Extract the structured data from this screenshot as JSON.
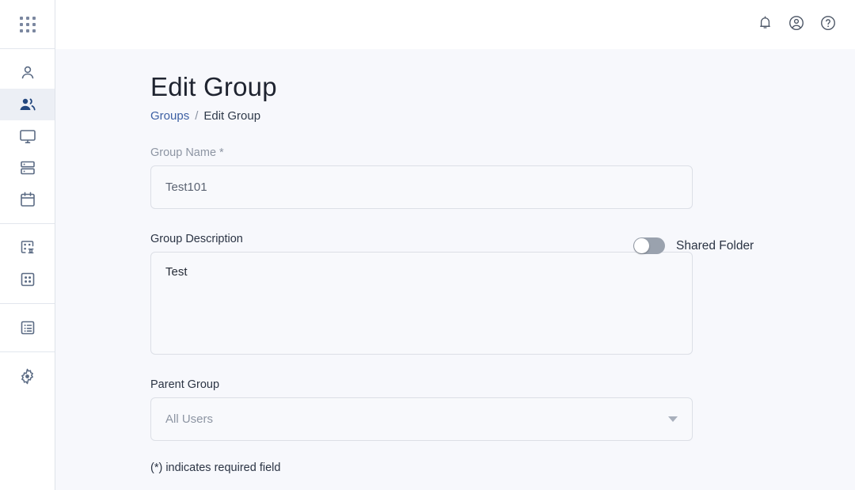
{
  "sidebar": {
    "launcher": {
      "name": "app-launcher",
      "icon": "apps-grid-icon"
    },
    "items": [
      {
        "icon": "user-icon",
        "name": "sidebar-item-users",
        "active": false
      },
      {
        "icon": "group-users-icon",
        "name": "sidebar-item-groups",
        "active": true
      },
      {
        "icon": "monitor-icon",
        "name": "sidebar-item-devices",
        "active": false
      },
      {
        "icon": "server-icon",
        "name": "sidebar-item-servers",
        "active": false
      },
      {
        "icon": "calendar-icon",
        "name": "sidebar-item-calendar",
        "active": false
      },
      {
        "icon": "link-app-icon",
        "name": "sidebar-item-sso-apps",
        "active": false
      },
      {
        "icon": "grid-square-icon",
        "name": "sidebar-item-apps",
        "active": false
      },
      {
        "icon": "list-icon",
        "name": "sidebar-item-directory",
        "active": false
      },
      {
        "icon": "gear-icon",
        "name": "sidebar-item-settings",
        "active": false
      }
    ]
  },
  "topbar": {
    "icons": [
      {
        "name": "notifications-bell-icon",
        "label": "Notifications"
      },
      {
        "name": "account-circle-icon",
        "label": "Account"
      },
      {
        "name": "help-circle-icon",
        "label": "Help"
      }
    ]
  },
  "page": {
    "title": "Edit Group",
    "breadcrumb": {
      "link": "Groups",
      "separator": "/",
      "current": "Edit Group"
    }
  },
  "form": {
    "group_name": {
      "label": "Group Name *",
      "value": "Test101",
      "placeholder": "Group Name"
    },
    "shared_folder": {
      "label": "Shared Folder",
      "enabled": false
    },
    "group_description": {
      "label": "Group Description",
      "value": "Test",
      "placeholder": "Group Description"
    },
    "parent_group": {
      "label": "Parent Group",
      "value": "All Users",
      "options": [
        "All Users"
      ]
    },
    "required_note": "(*) indicates required field"
  },
  "colors": {
    "accent_link": "#3c5fa3",
    "active_icon": "#23477e",
    "icon_default": "#5b6b84",
    "page_bg": "#f7f8fc",
    "panel_bg": "#ffffff",
    "border": "#dcdfe6"
  }
}
